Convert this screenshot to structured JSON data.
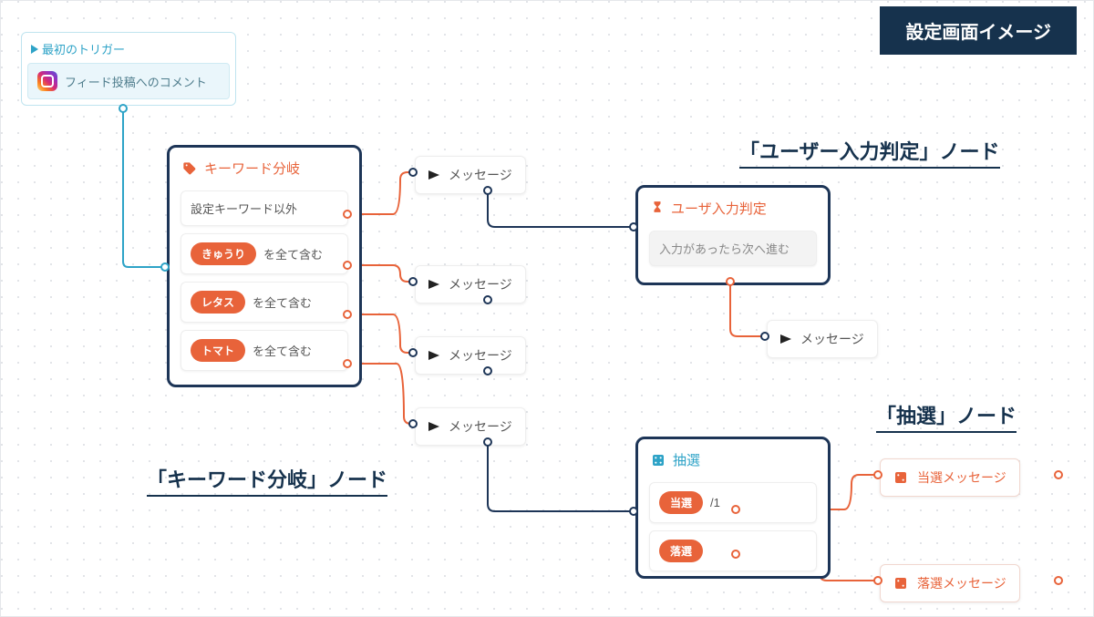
{
  "header_badge": "設定画面イメージ",
  "annotations": {
    "keyword_node": "「キーワード分岐」ノード",
    "userinput_node": "「ユーザー入力判定」ノード",
    "lottery_node": "「抽選」ノード"
  },
  "trigger": {
    "title": "最初のトリガー",
    "body": "フィード投稿へのコメント"
  },
  "keyword_branch": {
    "title": "キーワード分岐",
    "else_label": "設定キーワード以外",
    "contains_suffix": "を全て含む",
    "keywords": [
      "きゅうり",
      "レタス",
      "トマト"
    ]
  },
  "user_input": {
    "title": "ユーザ入力判定",
    "body": "入力があったら次へ進む"
  },
  "lottery": {
    "title": "抽選",
    "win_pill": "当選",
    "win_suffix": "/1",
    "lose_pill": "落選"
  },
  "messages": {
    "label": "メッセージ"
  },
  "result_cards": {
    "win": "当選メッセージ",
    "lose": "落選メッセージ"
  }
}
